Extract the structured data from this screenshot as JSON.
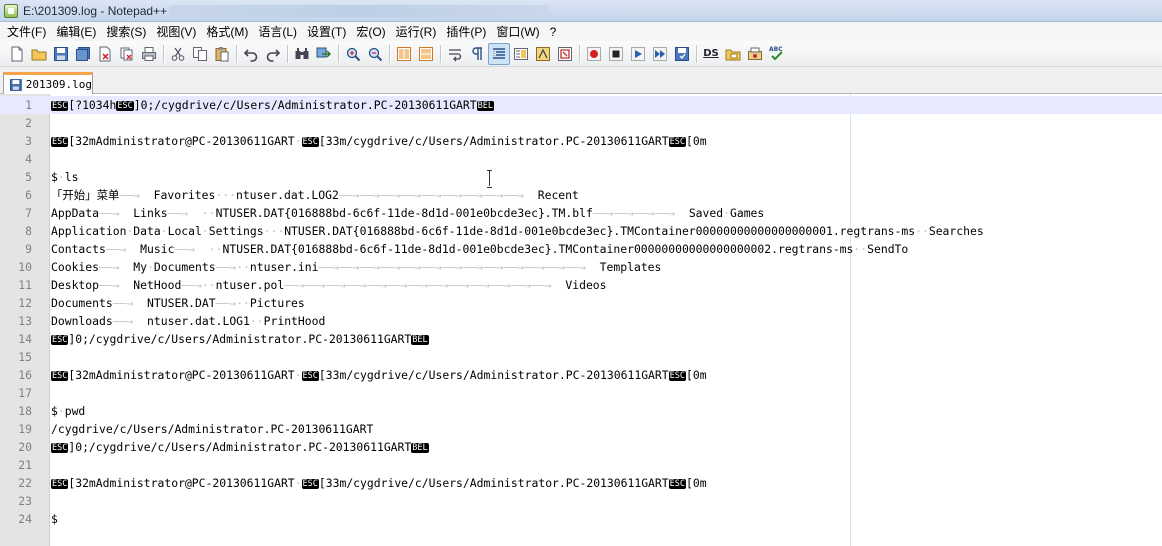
{
  "window": {
    "title": "E:\\201309.log - Notepad++"
  },
  "menu": [
    "文件(F)",
    "编辑(E)",
    "搜索(S)",
    "视图(V)",
    "格式(M)",
    "语言(L)",
    "设置(T)",
    "宏(O)",
    "运行(R)",
    "插件(P)",
    "窗口(W)",
    "?"
  ],
  "toolbar": {
    "buttons": [
      "new-file-icon",
      "open-file-icon",
      "save-icon",
      "save-all-icon",
      "close-icon",
      "close-all-icon",
      "print-icon",
      "cut-icon",
      "copy-icon",
      "paste-icon",
      "undo-icon",
      "redo-icon",
      "find-icon",
      "replace-icon",
      "zoom-in-icon",
      "zoom-out-icon",
      "sync-vertical-icon",
      "sync-horizontal-icon",
      "word-wrap-icon",
      "show-all-chars-icon",
      "indent-guide-icon",
      "document-map-icon",
      "function-list-icon",
      "folder-as-workspace-icon",
      "record-macro-icon",
      "stop-record-icon",
      "playback-macro-icon",
      "run-macro-multiple-icon",
      "save-macro-icon",
      "ds-icon",
      "open-folder-icon",
      "plugin-icon",
      "spellcheck-icon"
    ],
    "ds_label": "DS",
    "spell_label": "ABC"
  },
  "tab": {
    "label": "201309.log"
  },
  "editor": {
    "current_line": 1,
    "lines": [
      {
        "n": "1",
        "segments": [
          [
            "c",
            "ESC"
          ],
          [
            "t",
            "[?1034h"
          ],
          [
            "c",
            "ESC"
          ],
          [
            "t",
            "]0;/cygdrive/c/Users/Administrator.PC-20130611GART"
          ],
          [
            "c",
            "BEL"
          ]
        ]
      },
      {
        "n": "2",
        "segments": []
      },
      {
        "n": "3",
        "segments": [
          [
            "c",
            "ESC"
          ],
          [
            "t",
            "[32mAdministrator@PC-20130611GART"
          ],
          [
            "w",
            "·"
          ],
          [
            "c",
            "ESC"
          ],
          [
            "t",
            "[33m/cygdrive/c/Users/Administrator.PC-20130611GART"
          ],
          [
            "c",
            "ESC"
          ],
          [
            "t",
            "[0m"
          ]
        ]
      },
      {
        "n": "4",
        "segments": []
      },
      {
        "n": "5",
        "segments": [
          [
            "t",
            "$"
          ],
          [
            "w",
            "·"
          ],
          [
            "t",
            "ls"
          ]
        ]
      },
      {
        "n": "6",
        "segments": [
          [
            "t",
            "「开始」菜单"
          ],
          [
            "w",
            "——→"
          ],
          [
            "t",
            "  "
          ],
          [
            "t",
            "Favorites"
          ],
          [
            "w",
            "···"
          ],
          [
            "t",
            "ntuser.dat.LOG2"
          ],
          [
            "w",
            "——→——→——→——→——→——→——→——→——→"
          ],
          [
            "t",
            "  "
          ],
          [
            "t",
            "Recent"
          ]
        ]
      },
      {
        "n": "7",
        "segments": [
          [
            "t",
            "AppData"
          ],
          [
            "w",
            "——→"
          ],
          [
            "t",
            "  Links"
          ],
          [
            "w",
            "——→"
          ],
          [
            "t",
            "  "
          ],
          [
            "w",
            "··"
          ],
          [
            "t",
            "NTUSER.DAT{016888bd-6c6f-11de-8d1d-001e0bcde3ec}.TM.blf"
          ],
          [
            "w",
            "——→——→——→——→"
          ],
          [
            "t",
            "  Saved"
          ],
          [
            "w",
            "·"
          ],
          [
            "t",
            "Games"
          ]
        ]
      },
      {
        "n": "8",
        "segments": [
          [
            "t",
            "Application"
          ],
          [
            "w",
            "·"
          ],
          [
            "t",
            "Data"
          ],
          [
            "w",
            "·"
          ],
          [
            "t",
            "Local"
          ],
          [
            "w",
            "·"
          ],
          [
            "t",
            "Settings"
          ],
          [
            "w",
            "···"
          ],
          [
            "t",
            "NTUSER.DAT{016888bd-6c6f-11de-8d1d-001e0bcde3ec}.TMContainer00000000000000000001.regtrans-ms"
          ],
          [
            "w",
            "··"
          ],
          [
            "t",
            "Searches"
          ]
        ]
      },
      {
        "n": "9",
        "segments": [
          [
            "t",
            "Contacts"
          ],
          [
            "w",
            "——→"
          ],
          [
            "t",
            "  Music"
          ],
          [
            "w",
            "——→"
          ],
          [
            "t",
            "  "
          ],
          [
            "w",
            "··"
          ],
          [
            "t",
            "NTUSER.DAT{016888bd-6c6f-11de-8d1d-001e0bcde3ec}.TMContainer00000000000000000002.regtrans-ms"
          ],
          [
            "w",
            "··"
          ],
          [
            "t",
            "SendTo"
          ]
        ]
      },
      {
        "n": "10",
        "segments": [
          [
            "t",
            "Cookies"
          ],
          [
            "w",
            "——→"
          ],
          [
            "t",
            "  My"
          ],
          [
            "w",
            "·"
          ],
          [
            "t",
            "Documents"
          ],
          [
            "w",
            "——→"
          ],
          [
            "w",
            "··"
          ],
          [
            "t",
            "ntuser.ini"
          ],
          [
            "w",
            "——→——→——→——→——→——→——→——→——→——→——→——→——→"
          ],
          [
            "t",
            "  Templates"
          ]
        ]
      },
      {
        "n": "11",
        "segments": [
          [
            "t",
            "Desktop"
          ],
          [
            "w",
            "——→"
          ],
          [
            "t",
            "  NetHood"
          ],
          [
            "w",
            "——→"
          ],
          [
            "w",
            "··"
          ],
          [
            "t",
            "ntuser.pol"
          ],
          [
            "w",
            "——→——→——→——→——→——→——→——→——→——→——→——→——→"
          ],
          [
            "t",
            "  Videos"
          ]
        ]
      },
      {
        "n": "12",
        "segments": [
          [
            "t",
            "Documents"
          ],
          [
            "w",
            "——→"
          ],
          [
            "t",
            "  NTUSER.DAT"
          ],
          [
            "w",
            "——→"
          ],
          [
            "w",
            "··"
          ],
          [
            "t",
            "Pictures"
          ]
        ]
      },
      {
        "n": "13",
        "segments": [
          [
            "t",
            "Downloads"
          ],
          [
            "w",
            "——→"
          ],
          [
            "t",
            "  ntuser.dat.LOG1"
          ],
          [
            "w",
            "··"
          ],
          [
            "t",
            "PrintHood"
          ]
        ]
      },
      {
        "n": "14",
        "segments": [
          [
            "c",
            "ESC"
          ],
          [
            "t",
            "]0;/cygdrive/c/Users/Administrator.PC-20130611GART"
          ],
          [
            "c",
            "BEL"
          ]
        ]
      },
      {
        "n": "15",
        "segments": []
      },
      {
        "n": "16",
        "segments": [
          [
            "c",
            "ESC"
          ],
          [
            "t",
            "[32mAdministrator@PC-20130611GART"
          ],
          [
            "w",
            "·"
          ],
          [
            "c",
            "ESC"
          ],
          [
            "t",
            "[33m/cygdrive/c/Users/Administrator.PC-20130611GART"
          ],
          [
            "c",
            "ESC"
          ],
          [
            "t",
            "[0m"
          ]
        ]
      },
      {
        "n": "17",
        "segments": []
      },
      {
        "n": "18",
        "segments": [
          [
            "t",
            "$"
          ],
          [
            "w",
            "·"
          ],
          [
            "t",
            "pwd"
          ]
        ]
      },
      {
        "n": "19",
        "segments": [
          [
            "t",
            "/cygdrive/c/Users/Administrator.PC-20130611GART"
          ]
        ]
      },
      {
        "n": "20",
        "segments": [
          [
            "c",
            "ESC"
          ],
          [
            "t",
            "]0;/cygdrive/c/Users/Administrator.PC-20130611GART"
          ],
          [
            "c",
            "BEL"
          ]
        ]
      },
      {
        "n": "21",
        "segments": []
      },
      {
        "n": "22",
        "segments": [
          [
            "c",
            "ESC"
          ],
          [
            "t",
            "[32mAdministrator@PC-20130611GART"
          ],
          [
            "w",
            "·"
          ],
          [
            "c",
            "ESC"
          ],
          [
            "t",
            "[33m/cygdrive/c/Users/Administrator.PC-20130611GART"
          ],
          [
            "c",
            "ESC"
          ],
          [
            "t",
            "[0m"
          ]
        ]
      },
      {
        "n": "23",
        "segments": []
      },
      {
        "n": "24",
        "segments": [
          [
            "t",
            "$"
          ]
        ]
      }
    ]
  },
  "colors": {
    "current_line_bg": "#e8e8ff",
    "gutter_bg": "#e4e4e4",
    "tab_accent": "#f7a34b",
    "whitespace_symbol": "#c0c0c0"
  }
}
